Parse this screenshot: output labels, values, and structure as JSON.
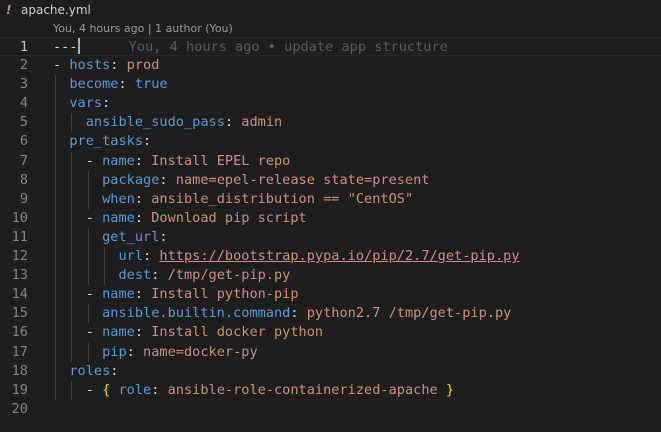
{
  "tab": {
    "icon": "!",
    "icon_name": "yaml-file-icon",
    "title": "apache.yml"
  },
  "codelens": "You, 4 hours ago | 1 author (You)",
  "inline_blame": "You, 4 hours ago • update app structure",
  "colors": {
    "background": "#1e1e1e",
    "key": "#569cd6",
    "string": "#ce9178",
    "punctuation": "#d4d4d4",
    "bracket": "#ffd700",
    "line_number": "#858585"
  },
  "lines": [
    {
      "n": "1",
      "tokens": [
        {
          "t": "---",
          "c": "sep"
        }
      ]
    },
    {
      "n": "2",
      "tokens": [
        {
          "t": "- ",
          "c": "p"
        },
        {
          "t": "hosts",
          "c": "k"
        },
        {
          "t": ": ",
          "c": "p"
        },
        {
          "t": "prod",
          "c": "s"
        }
      ]
    },
    {
      "n": "3",
      "tokens": [
        {
          "t": "  ",
          "c": "p"
        },
        {
          "t": "become",
          "c": "k"
        },
        {
          "t": ": ",
          "c": "p"
        },
        {
          "t": "true",
          "c": "k"
        }
      ]
    },
    {
      "n": "4",
      "tokens": [
        {
          "t": "  ",
          "c": "p"
        },
        {
          "t": "vars",
          "c": "k"
        },
        {
          "t": ":",
          "c": "p"
        }
      ]
    },
    {
      "n": "5",
      "tokens": [
        {
          "t": "    ",
          "c": "p"
        },
        {
          "t": "ansible_sudo_pass",
          "c": "k"
        },
        {
          "t": ": ",
          "c": "p"
        },
        {
          "t": "admin",
          "c": "s"
        }
      ]
    },
    {
      "n": "6",
      "tokens": [
        {
          "t": "  ",
          "c": "p"
        },
        {
          "t": "pre_tasks",
          "c": "k"
        },
        {
          "t": ":",
          "c": "p"
        }
      ]
    },
    {
      "n": "7",
      "tokens": [
        {
          "t": "    - ",
          "c": "p"
        },
        {
          "t": "name",
          "c": "k"
        },
        {
          "t": ": ",
          "c": "p"
        },
        {
          "t": "Install EPEL repo",
          "c": "s"
        }
      ]
    },
    {
      "n": "8",
      "tokens": [
        {
          "t": "      ",
          "c": "p"
        },
        {
          "t": "package",
          "c": "k"
        },
        {
          "t": ": ",
          "c": "p"
        },
        {
          "t": "name=epel-release state=present",
          "c": "s"
        }
      ]
    },
    {
      "n": "9",
      "tokens": [
        {
          "t": "      ",
          "c": "p"
        },
        {
          "t": "when",
          "c": "k"
        },
        {
          "t": ": ",
          "c": "p"
        },
        {
          "t": "ansible_distribution == \"CentOS\"",
          "c": "s"
        }
      ]
    },
    {
      "n": "10",
      "tokens": [
        {
          "t": "    - ",
          "c": "p"
        },
        {
          "t": "name",
          "c": "k"
        },
        {
          "t": ": ",
          "c": "p"
        },
        {
          "t": "Download pip script",
          "c": "s"
        }
      ]
    },
    {
      "n": "11",
      "tokens": [
        {
          "t": "      ",
          "c": "p"
        },
        {
          "t": "get_url",
          "c": "k"
        },
        {
          "t": ":",
          "c": "p"
        }
      ]
    },
    {
      "n": "12",
      "tokens": [
        {
          "t": "        ",
          "c": "p"
        },
        {
          "t": "url",
          "c": "k"
        },
        {
          "t": ": ",
          "c": "p"
        },
        {
          "t": "https://bootstrap.pypa.io/pip/2.7/get-pip.py",
          "c": "link"
        }
      ]
    },
    {
      "n": "13",
      "tokens": [
        {
          "t": "        ",
          "c": "p"
        },
        {
          "t": "dest",
          "c": "k"
        },
        {
          "t": ": ",
          "c": "p"
        },
        {
          "t": "/tmp/get-pip.py",
          "c": "s"
        }
      ]
    },
    {
      "n": "14",
      "tokens": [
        {
          "t": "    - ",
          "c": "p"
        },
        {
          "t": "name",
          "c": "k"
        },
        {
          "t": ": ",
          "c": "p"
        },
        {
          "t": "Install python-pip",
          "c": "s"
        }
      ]
    },
    {
      "n": "15",
      "tokens": [
        {
          "t": "      ",
          "c": "p"
        },
        {
          "t": "ansible.builtin.command",
          "c": "k"
        },
        {
          "t": ": ",
          "c": "p"
        },
        {
          "t": "python2.7 /tmp/get-pip.py",
          "c": "s"
        }
      ]
    },
    {
      "n": "16",
      "tokens": [
        {
          "t": "    - ",
          "c": "p"
        },
        {
          "t": "name",
          "c": "k"
        },
        {
          "t": ": ",
          "c": "p"
        },
        {
          "t": "Install docker python",
          "c": "s"
        }
      ]
    },
    {
      "n": "17",
      "tokens": [
        {
          "t": "      ",
          "c": "p"
        },
        {
          "t": "pip",
          "c": "k"
        },
        {
          "t": ": ",
          "c": "p"
        },
        {
          "t": "name=docker-py",
          "c": "s"
        }
      ]
    },
    {
      "n": "18",
      "tokens": [
        {
          "t": "  ",
          "c": "p"
        },
        {
          "t": "roles",
          "c": "k"
        },
        {
          "t": ":",
          "c": "p"
        }
      ]
    },
    {
      "n": "19",
      "tokens": [
        {
          "t": "    - ",
          "c": "p"
        },
        {
          "t": "{",
          "c": "b"
        },
        {
          "t": " ",
          "c": "p"
        },
        {
          "t": "role",
          "c": "k"
        },
        {
          "t": ": ",
          "c": "p"
        },
        {
          "t": "ansible-role-containerized-apache",
          "c": "s"
        },
        {
          "t": " ",
          "c": "p"
        },
        {
          "t": "}",
          "c": "b"
        }
      ]
    },
    {
      "n": "20",
      "tokens": []
    }
  ]
}
